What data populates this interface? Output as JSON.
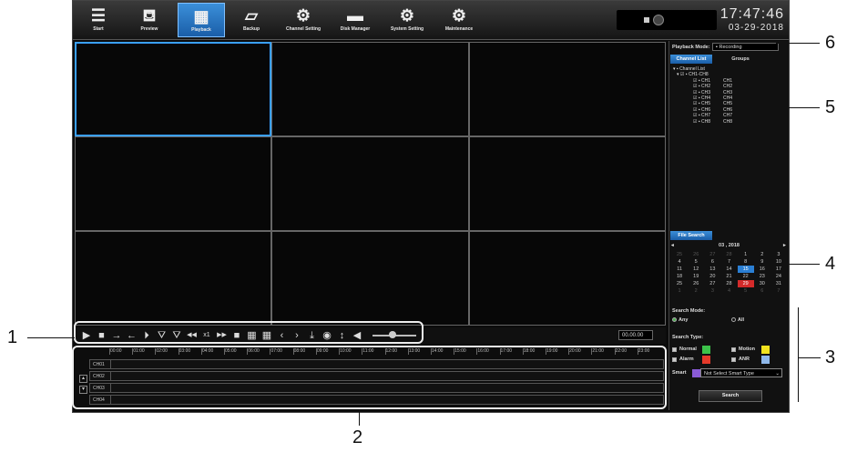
{
  "nav": {
    "items": [
      {
        "label": "Start",
        "icon": "list-icon"
      },
      {
        "label": "Preview",
        "icon": "camera-icon"
      },
      {
        "label": "Playback",
        "icon": "film-icon"
      },
      {
        "label": "Backup",
        "icon": "folder-icon"
      },
      {
        "label": "Channel Setting",
        "icon": "channel-gear-icon"
      },
      {
        "label": "Disk Manager",
        "icon": "disk-icon"
      },
      {
        "label": "System Setting",
        "icon": "system-gear-icon"
      },
      {
        "label": "Maintenance",
        "icon": "gear-icon"
      }
    ],
    "active": "Playback"
  },
  "clock": {
    "time": "17:47:46",
    "date": "03-29-2018"
  },
  "controls": {
    "speed_value": "00.00.00"
  },
  "timeline": {
    "hours": [
      "00:00",
      "01:00",
      "02:00",
      "03:00",
      "04:00",
      "05:00",
      "06:00",
      "07:00",
      "08:00",
      "09:00",
      "10:00",
      "11:00",
      "12:00",
      "13:00",
      "14:00",
      "15:00",
      "16:00",
      "17:00",
      "18:00",
      "19:00",
      "20:00",
      "21:00",
      "22:00",
      "23:00"
    ],
    "channels": [
      "CH01",
      "CH02",
      "CH03",
      "CH04"
    ]
  },
  "panel": {
    "playback_mode_label": "Playback Mode:",
    "playback_mode_value": "Recording",
    "tabs": [
      "Channel List",
      "Groups"
    ],
    "tree": {
      "root": "Channel List",
      "group": "CH1-CH8",
      "channels": [
        {
          "dev": "CH1",
          "name": "CH1"
        },
        {
          "dev": "CH2",
          "name": "CH2"
        },
        {
          "dev": "CH3",
          "name": "CH3"
        },
        {
          "dev": "CH4",
          "name": "CH4"
        },
        {
          "dev": "CH5",
          "name": "CH5"
        },
        {
          "dev": "CH6",
          "name": "CH6"
        },
        {
          "dev": "CH7",
          "name": "CH7"
        },
        {
          "dev": "CH8",
          "name": "CH8"
        }
      ]
    },
    "file_search_tab": "File Search",
    "calendar": {
      "month_year": "03 ,  2018",
      "weeks": [
        [
          "25",
          "26",
          "27",
          "28",
          "1",
          "2",
          "3"
        ],
        [
          "4",
          "5",
          "6",
          "7",
          "8",
          "9",
          "10"
        ],
        [
          "11",
          "12",
          "13",
          "14",
          "15",
          "16",
          "17"
        ],
        [
          "18",
          "19",
          "20",
          "21",
          "22",
          "23",
          "24"
        ],
        [
          "25",
          "26",
          "27",
          "28",
          "29",
          "30",
          "31"
        ],
        [
          "1",
          "2",
          "3",
          "4",
          "5",
          "6",
          "7"
        ]
      ],
      "highlight_blue": "15",
      "highlight_red": "29"
    },
    "search_mode_label": "Search Mode:",
    "mode_any": "Any",
    "mode_all": "All",
    "search_type_label": "Search Type:",
    "types": [
      {
        "label": "Normal",
        "color": "#3cc24a"
      },
      {
        "label": "Motion",
        "color": "#f2e21e"
      },
      {
        "label": "Alarm",
        "color": "#e53a2a"
      },
      {
        "label": "ANR",
        "color": "#8fb8ea"
      }
    ],
    "smart_label": "Smart",
    "smart_color": "#8a5bd6",
    "smart_value": "Not Select Smart Type",
    "search_button": "Search"
  },
  "callouts": [
    "1",
    "2",
    "3",
    "4",
    "5",
    "6"
  ]
}
